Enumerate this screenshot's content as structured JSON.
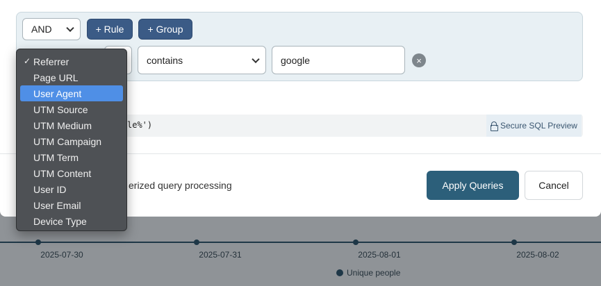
{
  "builder": {
    "operator_value": "AND",
    "add_rule_label": "+ Rule",
    "add_group_label": "+ Group",
    "condition_value": "contains",
    "text_value": "google",
    "remove_glyph": "×"
  },
  "field_dropdown": {
    "items": [
      "Referrer",
      "Page URL",
      "User Agent",
      "UTM Source",
      "UTM Medium",
      "UTM Campaign",
      "UTM Term",
      "UTM Content",
      "User ID",
      "User Email",
      "Device Type"
    ],
    "checked_index": 0,
    "highlighted_index": 2,
    "check_glyph": "✓"
  },
  "sql": {
    "partial_text": "le%')",
    "secure_preview_label": "Secure SQL Preview"
  },
  "footer": {
    "note_partial": "erized query processing",
    "apply_label": "Apply Queries",
    "cancel_label": "Cancel"
  },
  "background_chart": {
    "x_ticks": [
      "2025-07-30",
      "2025-07-31",
      "2025-08-01",
      "2025-08-02"
    ],
    "legend_label": "Unique people"
  },
  "colors": {
    "primary_button": "#3b5b86",
    "apply_button": "#2c5f7a",
    "highlight": "#4f8fe6"
  }
}
